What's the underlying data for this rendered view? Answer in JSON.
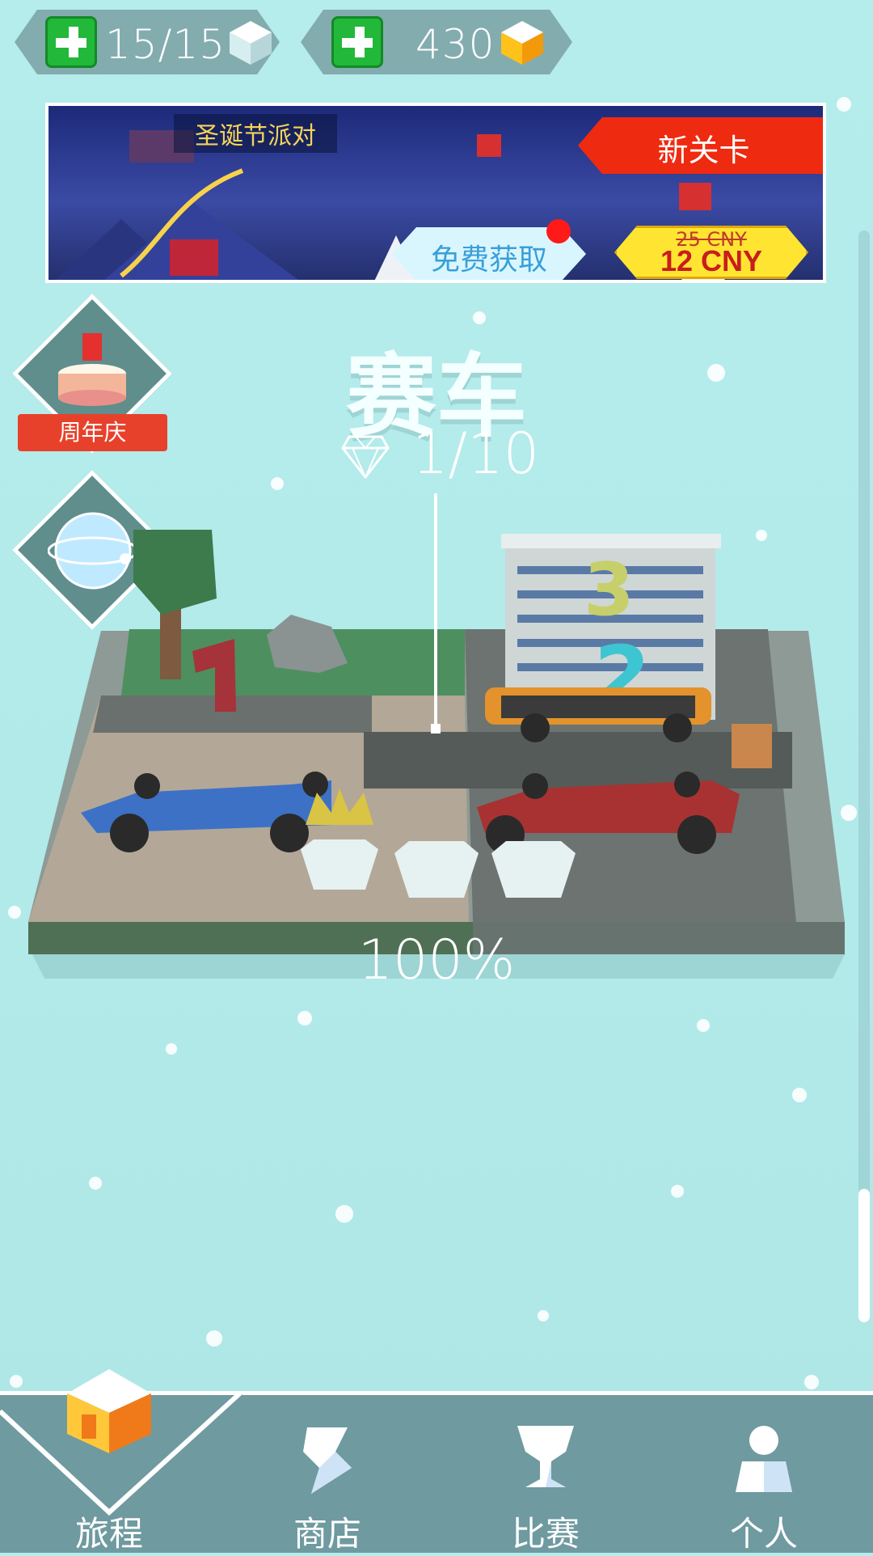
{
  "hud": {
    "lives": "15/15",
    "gems": "430"
  },
  "banner": {
    "title": "圣诞节派对",
    "new_level": "新关卡",
    "free_button": "免费获取",
    "old_price": "25 CNY",
    "price": "12 CNY"
  },
  "side": {
    "anniversary_label": "周年庆"
  },
  "level": {
    "name": "赛车",
    "gems_collected": "1/10",
    "progress": "100%"
  },
  "nav": {
    "items": [
      {
        "label": "旅程",
        "icon": "house-icon"
      },
      {
        "label": "商店",
        "icon": "shop-icon"
      },
      {
        "label": "比赛",
        "icon": "trophy-icon"
      },
      {
        "label": "个人",
        "icon": "person-icon"
      }
    ]
  },
  "colors": {
    "background": "#b5ecec",
    "nav": "#6e9aa0",
    "accent_green": "#22b83a",
    "accent_red": "#ee2a10",
    "accent_yellow": "#ffe531"
  }
}
